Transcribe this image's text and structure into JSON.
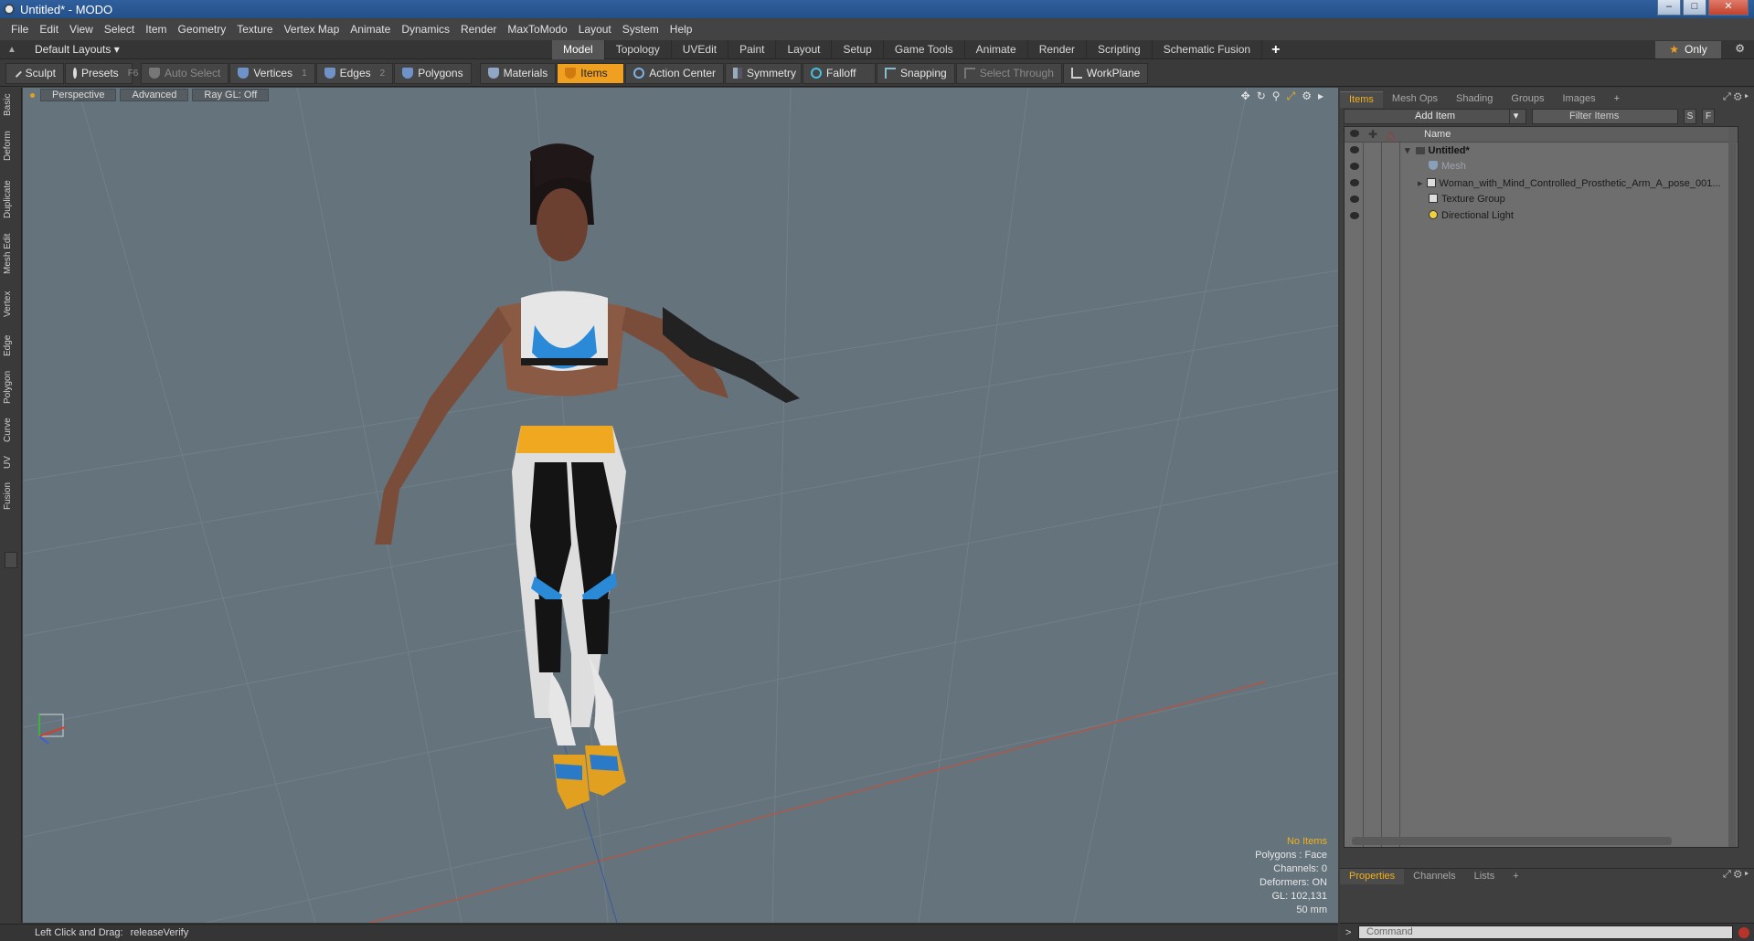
{
  "window": {
    "title": "Untitled* - MODO"
  },
  "menu": [
    "File",
    "Edit",
    "View",
    "Select",
    "Item",
    "Geometry",
    "Texture",
    "Vertex Map",
    "Animate",
    "Dynamics",
    "Render",
    "MaxToModo",
    "Layout",
    "System",
    "Help"
  ],
  "layout_bar": {
    "default_layouts": "Default Layouts ▾",
    "tabs": [
      "Model",
      "Topology",
      "UVEdit",
      "Paint",
      "Layout",
      "Setup",
      "Game Tools",
      "Animate",
      "Render",
      "Scripting",
      "Schematic Fusion"
    ],
    "active_tab": "Model",
    "add": "+",
    "only": "Only"
  },
  "toolbar": {
    "sculpt": "Sculpt",
    "presets": "Presets",
    "presets_key": "F6",
    "auto_select": "Auto Select",
    "vertices": "Vertices",
    "vertices_key": "1",
    "edges": "Edges",
    "edges_key": "2",
    "polygons": "Polygons",
    "materials": "Materials",
    "items": "Items",
    "action_center": "Action Center",
    "symmetry": "Symmetry",
    "falloff": "Falloff",
    "snapping": "Snapping",
    "select_through": "Select Through",
    "workplane": "WorkPlane"
  },
  "left_tabs": [
    "Basic",
    "Deform",
    "Duplicate",
    "Mesh Edit",
    "Vertex",
    "Edge",
    "Polygon",
    "Curve",
    "UV",
    "Fusion"
  ],
  "viewport": {
    "view": "Perspective",
    "advanced": "Advanced",
    "raygl": "Ray GL: Off",
    "info": {
      "no_items": "No Items",
      "polygons": "Polygons : Face",
      "channels": "Channels: 0",
      "deformers": "Deformers: ON",
      "gl": "GL: 102,131",
      "size": "50 mm"
    }
  },
  "status": {
    "label": "Left Click and Drag:",
    "value": "releaseVerify"
  },
  "panel": {
    "tabs": [
      "Items",
      "Mesh Ops",
      "Shading",
      "Groups",
      "Images"
    ],
    "active_tab": "Items",
    "add": "+",
    "add_item": "Add Item",
    "filter": "Filter Items",
    "s_btn": "S",
    "f_btn": "F",
    "name_header": "Name",
    "tree": {
      "root": "Untitled*",
      "mesh": "Mesh",
      "woman": "Woman_with_Mind_Controlled_Prosthetic_Arm_A_pose_001...",
      "texture": "Texture Group",
      "light": "Directional Light"
    },
    "bottom_tabs": [
      "Properties",
      "Channels",
      "Lists"
    ],
    "bottom_active": "Properties",
    "command_placeholder": "Command"
  },
  "colors": {
    "accent": "#f0a020",
    "viewport_bg": "#65737c",
    "panel_bg": "#3f3f3f"
  }
}
